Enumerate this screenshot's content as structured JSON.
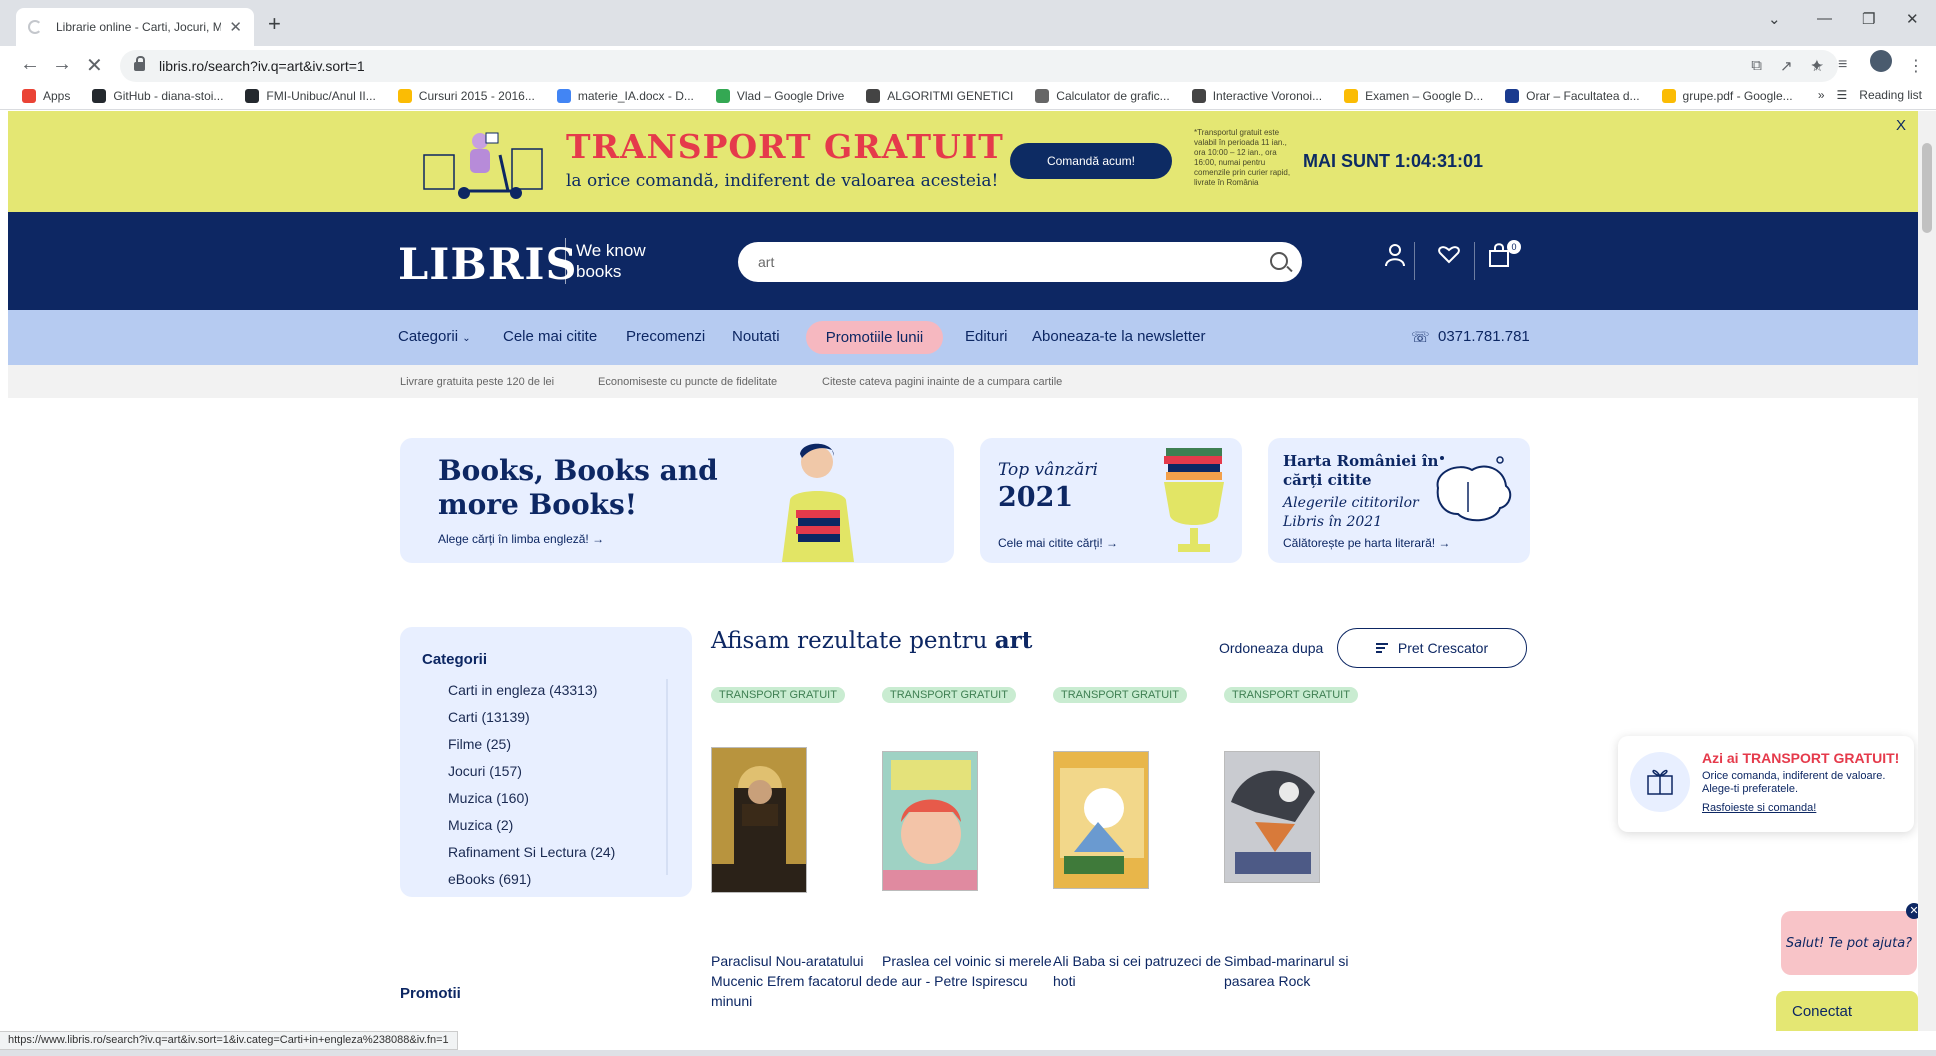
{
  "browser": {
    "tab_title": "Librarie online - Carti, Jocuri, Mu",
    "url": "libris.ro/search?iv.q=art&iv.sort=1",
    "bookmarks": [
      {
        "label": "Apps",
        "color": "#ea4335"
      },
      {
        "label": "GitHub - diana-stoi...",
        "color": "#24292e"
      },
      {
        "label": "FMI-Unibuc/Anul II...",
        "color": "#24292e"
      },
      {
        "label": "Cursuri 2015 - 2016...",
        "color": "#fbbc04"
      },
      {
        "label": "materie_IA.docx - D...",
        "color": "#4285f4"
      },
      {
        "label": "Vlad – Google Drive",
        "color": "#34a853"
      },
      {
        "label": "ALGORITMI GENETICI",
        "color": "#444444"
      },
      {
        "label": "Calculator de grafic...",
        "color": "#666666"
      },
      {
        "label": "Interactive Voronoi...",
        "color": "#444444"
      },
      {
        "label": "Examen – Google D...",
        "color": "#fbbc04"
      },
      {
        "label": "Orar – Facultatea d...",
        "color": "#1a3b8f"
      },
      {
        "label": "grupe.pdf - Google...",
        "color": "#fbbc04"
      }
    ],
    "reading_list": "Reading list",
    "status_url": "https://www.libris.ro/search?iv.q=art&iv.sort=1&iv.categ=Carti+in+engleza%238088&iv.fn=1"
  },
  "promo_bar": {
    "title": "TRANSPORT GRATUIT",
    "subtitle": "la orice comandă, indiferent de valoarea acesteia!",
    "button": "Comandă acum!",
    "note": "*Transportul gratuit este valabil în perioada 11 ian., ora 10:00 – 12 ian., ora 16:00, numai pentru comenzile prin curier rapid, livrate în România",
    "timer": "MAI SUNT 1:04:31:01",
    "close": "X"
  },
  "header": {
    "logo": "LIBRIS",
    "tagline": "We know books",
    "search_value": "art",
    "cart_count": "0"
  },
  "nav": {
    "items": [
      "Categorii",
      "Cele mai citite",
      "Precomenzi",
      "Noutati",
      "Promotiile lunii",
      "Edituri",
      "Aboneaza-te la newsletter"
    ],
    "phone": "0371.781.781"
  },
  "infobar": [
    "Livrare gratuita peste 120 de lei",
    "Economiseste cu puncte de fidelitate",
    "Citeste cateva pagini inainte de a cumpara cartile"
  ],
  "banners": [
    {
      "title": "Books, Books and more Books!",
      "link": "Alege cărți în limba engleză! →"
    },
    {
      "title": "Top vânzări",
      "year": "2021",
      "link": "Cele mai citite cărți! →"
    },
    {
      "title": "Harta României în cărți citite",
      "subtitle": "Alegerile cititorilor Libris în 2021",
      "link": "Călătorește pe harta literară! →"
    }
  ],
  "sidebar": {
    "heading": "Categorii",
    "categories": [
      "Carti in engleza (43313)",
      "Carti (13139)",
      "Filme (25)",
      "Jocuri (157)",
      "Muzica (160)",
      "Muzica (2)",
      "Rafinament Si Lectura (24)",
      "eBooks (691)"
    ],
    "promotii": "Promotii"
  },
  "results": {
    "prefix": "Afisam rezultate pentru",
    "query": "art",
    "sort_label": "Ordoneaza dupa",
    "sort_value": "Pret Crescator",
    "products": [
      {
        "badge": "TRANSPORT GRATUIT",
        "title": "Paraclisul Nou-aratatului Mucenic Efrem facatorul de minuni",
        "cover_color": "#c7a24a"
      },
      {
        "badge": "TRANSPORT GRATUIT",
        "title": "Praslea cel voinic si merele de aur - Petre Ispirescu",
        "cover_color": "#8fc7b8"
      },
      {
        "badge": "TRANSPORT GRATUIT",
        "title": "Ali Baba si cei patruzeci de hoti",
        "cover_color": "#e6b84a"
      },
      {
        "badge": "TRANSPORT GRATUIT",
        "title": "Simbad-marinarul si pasarea Rock",
        "cover_color": "#8a8f96"
      }
    ]
  },
  "toast": {
    "title": "Azi ai TRANSPORT GRATUIT!",
    "desc": "Orice comanda, indiferent de valoare. Alege-ti preferatele.",
    "link": "Rasfoieste si comanda!"
  },
  "chat": {
    "bubble": "Salut! Te pot ajuta?",
    "button": "Conectat"
  }
}
